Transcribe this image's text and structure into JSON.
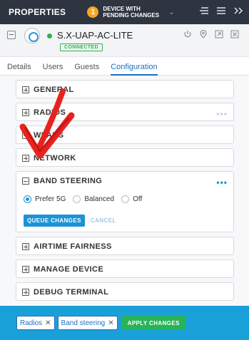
{
  "header": {
    "title": "PROPERTIES",
    "pending_count": "1",
    "pending_line1": "DEVICE WITH",
    "pending_line2": "PENDING CHANGES"
  },
  "device": {
    "name": "S.X-UAP-AC-LITE",
    "status": "CONNECTED",
    "status_color": "#2ab34b"
  },
  "tabs": [
    {
      "label": "Details"
    },
    {
      "label": "Users"
    },
    {
      "label": "Guests"
    },
    {
      "label": "Configuration",
      "active": true
    }
  ],
  "sections": {
    "general": "GENERAL",
    "radios": "RADIOS",
    "wlans": "WLANS",
    "network": "NETWORK",
    "band_steering": "BAND STEERING",
    "airtime": "AIRTIME FAIRNESS",
    "manage": "MANAGE DEVICE",
    "debug": "DEBUG TERMINAL"
  },
  "band_steering": {
    "options": [
      "Prefer 5G",
      "Balanced",
      "Off"
    ],
    "selected": "Prefer 5G",
    "queue_label": "QUEUE CHANGES",
    "cancel_label": "CANCEL"
  },
  "footer": {
    "chips": [
      "Radios",
      "Band steering"
    ],
    "apply_label": "APPLY CHANGES"
  },
  "colors": {
    "accent": "#1b93d6",
    "footer_bg": "#1aa0d8",
    "apply": "#27b35a",
    "annotation": "#e8231f"
  }
}
